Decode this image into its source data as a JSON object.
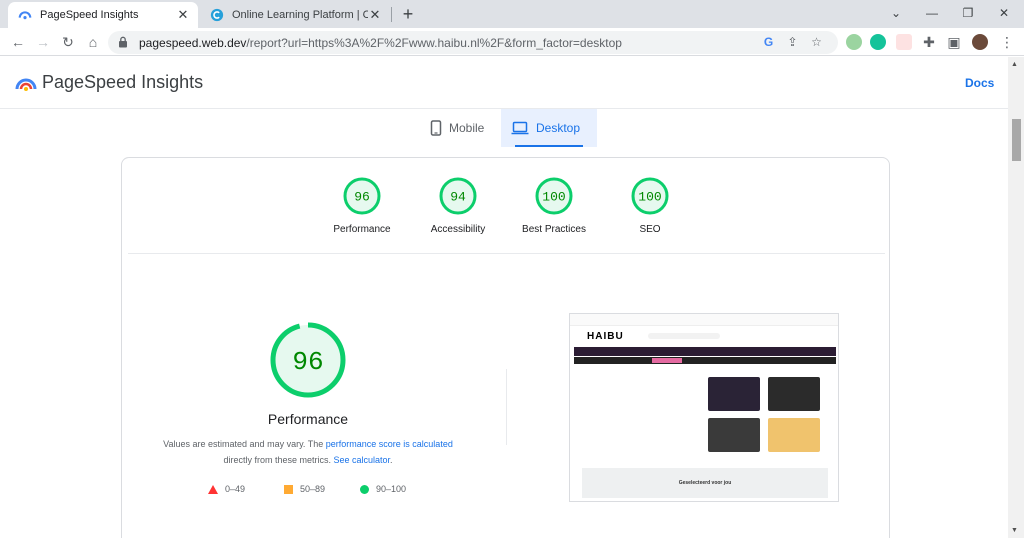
{
  "browser": {
    "tabs": [
      {
        "title": "PageSpeed Insights",
        "active": true
      },
      {
        "title": "Online Learning Platform | Corpo",
        "active": false
      }
    ],
    "url_host": "pagespeed.web.dev",
    "url_path": "/report?url=https%3A%2F%2Fwww.haibu.nl%2F&form_factor=desktop"
  },
  "header": {
    "brand": "PageSpeed Insights",
    "docs_link": "Docs"
  },
  "device_tabs": {
    "mobile": "Mobile",
    "desktop": "Desktop",
    "selected": "desktop"
  },
  "scores": [
    {
      "label": "Performance",
      "value": "96"
    },
    {
      "label": "Accessibility",
      "value": "94"
    },
    {
      "label": "Best Practices",
      "value": "100"
    },
    {
      "label": "SEO",
      "value": "100"
    }
  ],
  "performance": {
    "score": "96",
    "title": "Performance",
    "note_prefix": "Values are estimated and may vary. The ",
    "note_link1": "performance score is calculated",
    "note_middle": " directly from these metrics. ",
    "note_link2": "See calculator",
    "note_suffix": "."
  },
  "legend": [
    {
      "range": "0–49",
      "color": "#ff3333",
      "shape": "triangle"
    },
    {
      "range": "50–89",
      "color": "#ffaa33",
      "shape": "square"
    },
    {
      "range": "90–100",
      "color": "#0cce6b",
      "shape": "circle"
    }
  ],
  "screenshot": {
    "logo": "HAIBU",
    "section_title": "Geselecteerd voor jou"
  },
  "colors": {
    "pass": "#0cce6b",
    "pass_bg": "#e6f9ef",
    "pass_text": "#008800",
    "accent": "#1a73e8"
  }
}
